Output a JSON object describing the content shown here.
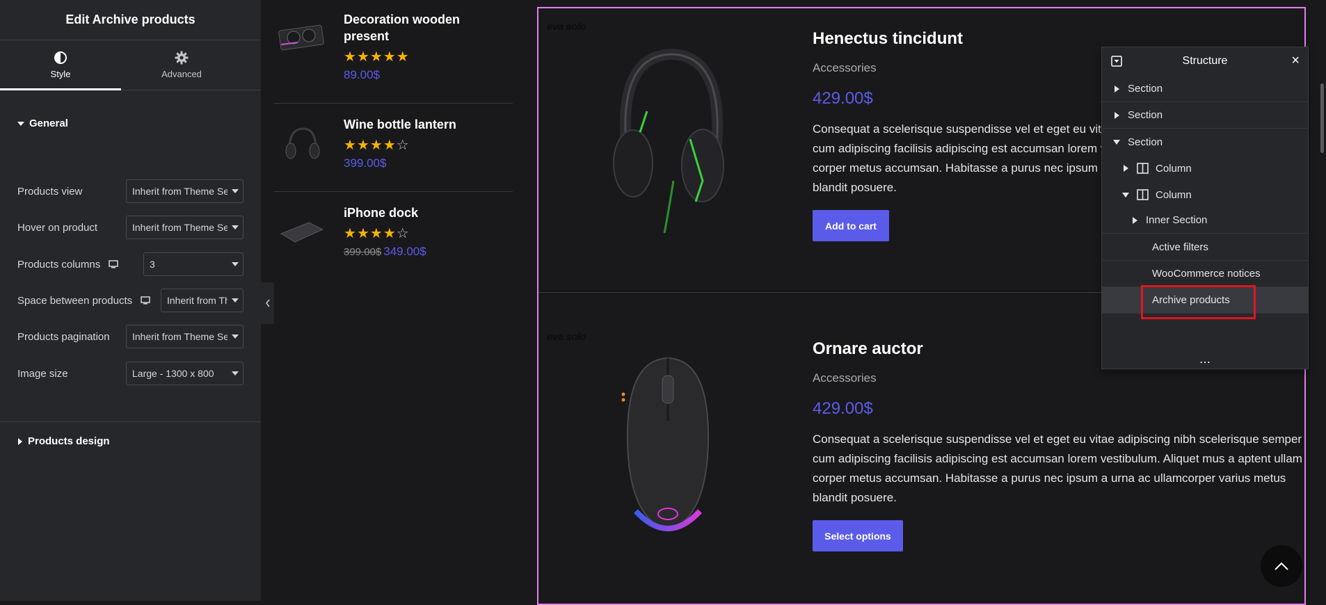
{
  "editor": {
    "title": "Edit Archive products",
    "tabs": [
      {
        "label": "Style",
        "icon": "contrast-icon",
        "active": true
      },
      {
        "label": "Advanced",
        "icon": "gear-icon",
        "active": false
      }
    ],
    "general_section": "General",
    "controls": [
      {
        "label": "Products view",
        "value": "Inherit from Theme Settings",
        "responsive": false
      },
      {
        "label": "Hover on product",
        "value": "Inherit from Theme Settings",
        "responsive": false
      },
      {
        "label": "Products columns",
        "value": "3",
        "responsive": true
      },
      {
        "label": "Space between products",
        "value": "Inherit from Theme",
        "responsive": true
      },
      {
        "label": "Products pagination",
        "value": "Inherit from Theme Settings",
        "responsive": false
      },
      {
        "label": "Image size",
        "value": "Large - 1300 x 800",
        "responsive": false
      }
    ],
    "design_section": "Products design"
  },
  "mini_products": [
    {
      "title_line1": "Decoration wooden",
      "title_line2": "present",
      "rating": 5,
      "old_price": "",
      "price": "89.00$",
      "image": "graphics-card-image"
    },
    {
      "title_line1": "Wine bottle lantern",
      "title_line2": "",
      "rating": 4,
      "old_price": "",
      "price": "399.00$",
      "image": "headphones-image"
    },
    {
      "title_line1": "iPhone dock",
      "title_line2": "",
      "rating": 4,
      "old_price": "399.00$",
      "price": "349.00$",
      "image": "mousepad-image"
    }
  ],
  "products": [
    {
      "brand": "eva solo",
      "title": "Henectus tincidunt",
      "category": "Accessories",
      "price": "429.00$",
      "desc_lines": [
        "Consequat a scelerisque suspendisse vel et eget eu vitae adipiscing nibh scelerisque semper",
        "cum adipiscing facilisis adipiscing est accumsan lorem vestibulum. Aliquet mus a aptent ullam",
        "corper metus accumsan. Habitasse a purus nec ipsum a urna ac ullamcorper varius metus",
        "blandit posuere."
      ],
      "button": "Add to cart"
    },
    {
      "brand": "eva solo",
      "title": "Ornare auctor",
      "category": "Accessories",
      "price": "429.00$",
      "desc_lines": [
        "Consequat a scelerisque suspendisse vel et eget eu vitae adipiscing nibh scelerisque semper",
        "cum adipiscing facilisis adipiscing est accumsan lorem vestibulum. Aliquet mus a aptent ullam",
        "corper metus accumsan. Habitasse a purus nec ipsum a urna ac ullamcorper varius metus",
        "blandit posuere."
      ],
      "button": "Select options"
    }
  ],
  "structure": {
    "title": "Structure",
    "items": [
      {
        "label": "Section",
        "expanded": false,
        "type": "section"
      },
      {
        "label": "Section",
        "expanded": false,
        "type": "section"
      },
      {
        "label": "Section",
        "expanded": true,
        "type": "section"
      },
      {
        "label": "Column",
        "expanded": false,
        "type": "column"
      },
      {
        "label": "Column",
        "expanded": true,
        "type": "column"
      },
      {
        "label": "Inner Section",
        "expanded": false,
        "type": "inner"
      },
      {
        "label": "Active filters",
        "type": "widget"
      },
      {
        "label": "WooCommerce notices",
        "type": "widget"
      },
      {
        "label": "Archive products",
        "type": "widget",
        "selected": true
      }
    ],
    "more": "⋯"
  },
  "colors": {
    "accent": "#5b5bea",
    "panel_bg": "#26272b",
    "page_bg": "#19191b",
    "highlight": "#e0161e",
    "edit_outline": "#e57ef0",
    "star": "#f5b301"
  }
}
